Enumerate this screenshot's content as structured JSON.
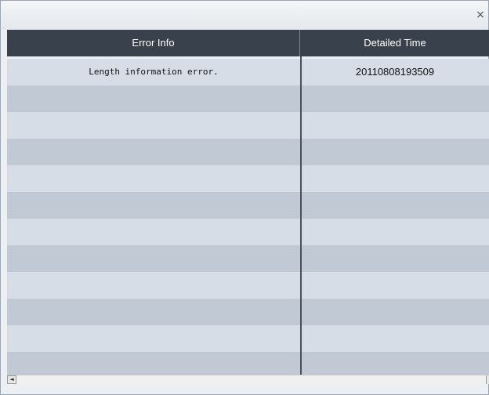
{
  "window": {
    "close_glyph": "×"
  },
  "table": {
    "columns": [
      "Error Info",
      "Detailed Time"
    ],
    "rows": [
      [
        "Length information error.",
        "20110808193509"
      ],
      [
        "",
        ""
      ],
      [
        "",
        ""
      ],
      [
        "",
        ""
      ],
      [
        "",
        ""
      ],
      [
        "",
        ""
      ],
      [
        "",
        ""
      ],
      [
        "",
        ""
      ],
      [
        "",
        ""
      ],
      [
        "",
        ""
      ],
      [
        "",
        ""
      ],
      [
        "",
        ""
      ],
      [
        "",
        ""
      ]
    ]
  },
  "scrollbar": {
    "left_arrow_glyph": "◄"
  }
}
